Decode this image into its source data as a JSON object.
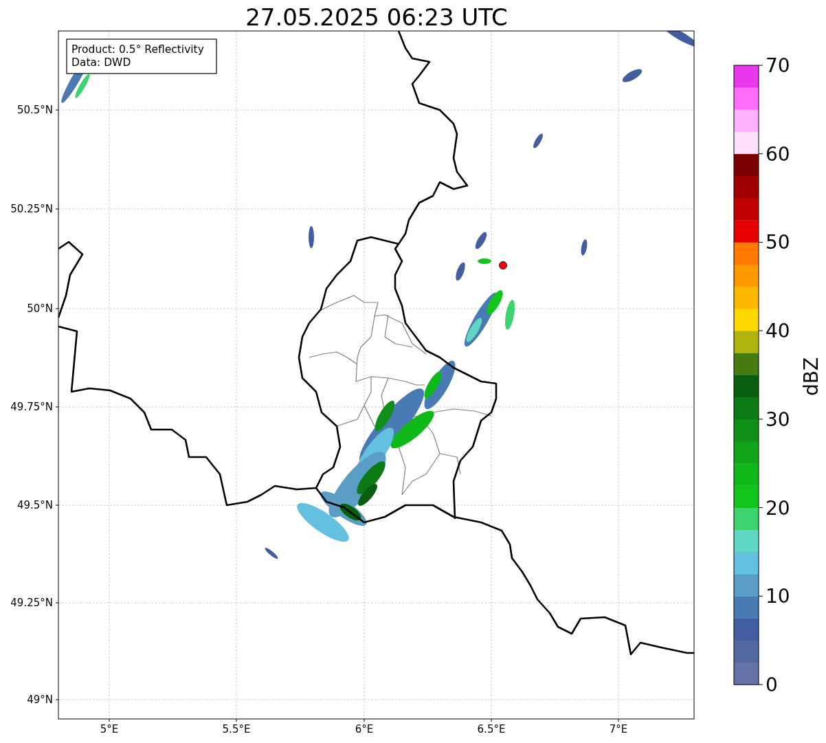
{
  "title": "27.05.2025 06:23 UTC",
  "map": {
    "legend": [
      "Product: 0.5° Reflectivity",
      "Data: DWD"
    ],
    "lat_labels": [
      "50.5°N",
      "50.25°N",
      "50°N",
      "49.75°N",
      "49.5°N",
      "49.25°N",
      "49°N"
    ],
    "lon_labels": [
      "5°E",
      "5.5°E",
      "6°E",
      "6.5°E",
      "7°E"
    ],
    "radar_site": {
      "color": "#ff0000"
    }
  },
  "colorbar": {
    "label": "dBZ",
    "ticks": [
      "70",
      "60",
      "50",
      "40",
      "30",
      "20",
      "10",
      "0"
    ],
    "bins": [
      {
        "color": "#6474a8"
      },
      {
        "color": "#5468a0"
      },
      {
        "color": "#425ea0"
      },
      {
        "color": "#4a7ab3"
      },
      {
        "color": "#5a9ec6"
      },
      {
        "color": "#63c0de"
      },
      {
        "color": "#5fd7c7"
      },
      {
        "color": "#3dd46f"
      },
      {
        "color": "#12c51a"
      },
      {
        "color": "#10b91a"
      },
      {
        "color": "#10a519"
      },
      {
        "color": "#0f8f18"
      },
      {
        "color": "#0b7a15"
      },
      {
        "color": "#0a5e10"
      },
      {
        "color": "#477a10"
      },
      {
        "color": "#b0b30a"
      },
      {
        "color": "#ffd700"
      },
      {
        "color": "#ffb800"
      },
      {
        "color": "#ff9900"
      },
      {
        "color": "#ff7a00"
      },
      {
        "color": "#e60000"
      },
      {
        "color": "#c00000"
      },
      {
        "color": "#a00000"
      },
      {
        "color": "#7a0000"
      },
      {
        "color": "#ffe0ff"
      },
      {
        "color": "#ffb2ff"
      },
      {
        "color": "#ff6cf5"
      },
      {
        "color": "#ea36ec"
      }
    ]
  }
}
